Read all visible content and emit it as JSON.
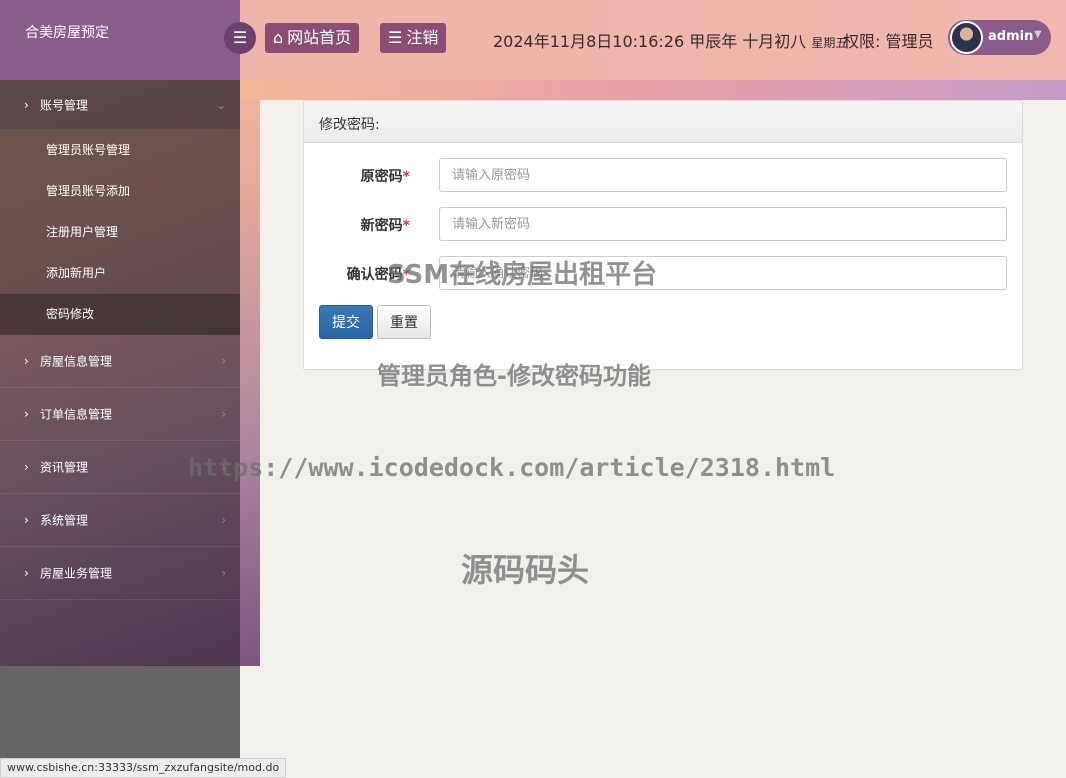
{
  "app": {
    "brand": "合美房屋预定"
  },
  "topbar": {
    "toggle_icon": "bars-icon",
    "home_label": "网站首页",
    "logout_label": "注销",
    "datetime": "2024年11月8日10:16:26 甲辰年 十月初八",
    "weekday": "星期五",
    "permission": "权限: 管理员",
    "user": "admin"
  },
  "sidebar": {
    "account": {
      "label": "账号管理"
    },
    "sub_items": [
      {
        "label": "管理员账号管理"
      },
      {
        "label": "管理员账号添加"
      },
      {
        "label": "注册用户管理"
      },
      {
        "label": "添加新用户"
      },
      {
        "label": "密码修改"
      }
    ],
    "items": [
      {
        "label": "房屋信息管理"
      },
      {
        "label": "订单信息管理"
      },
      {
        "label": "资讯管理"
      },
      {
        "label": "系统管理"
      },
      {
        "label": "房屋业务管理"
      }
    ]
  },
  "form": {
    "title": "修改密码:",
    "fields": [
      {
        "label": "原密码",
        "required": "*",
        "placeholder": "请输入原密码"
      },
      {
        "label": "新密码",
        "required": "*",
        "placeholder": "请输入新密码"
      },
      {
        "label": "确认密码",
        "required": "*",
        "placeholder": "请输入确认密码"
      }
    ],
    "submit_label": "提交",
    "reset_label": "重置"
  },
  "watermarks": {
    "line1": "SSM在线房屋出租平台",
    "line2": "管理员角色-修改密码功能",
    "line3": "https://www.icodedock.com/article/2318.html",
    "line4": "源码码头"
  },
  "statusbar": {
    "url": "www.csbishe.cn:33333/ssm_zxzufangsite/mod.do"
  },
  "colors": {
    "brand": "#8a5c8c",
    "topbar": "#f0b8ae",
    "primary": "#2866a0",
    "required": "#d33333"
  }
}
